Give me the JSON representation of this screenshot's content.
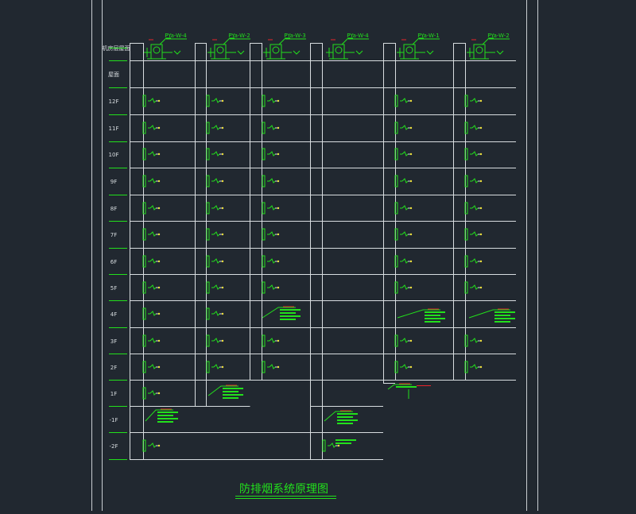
{
  "title": "防排烟系统原理图",
  "roof_label": "机房层屋面",
  "floors": [
    "屋面",
    "12F",
    "11F",
    "10F",
    "9F",
    "8F",
    "7F",
    "6F",
    "5F",
    "4F",
    "3F",
    "2F",
    "1F",
    "-1F",
    "-2F"
  ],
  "fan_labels": [
    "PYa-W-4",
    "PYa-W-2",
    "PYa-W-3",
    "PYa-W-4",
    "PYa-W-1",
    "PYa-W-2"
  ],
  "colors": {
    "background": "#212830",
    "line": "#d8dde0",
    "equipment": "#22e01c",
    "accent": "#e8242a",
    "valve": "#f0e23a"
  }
}
